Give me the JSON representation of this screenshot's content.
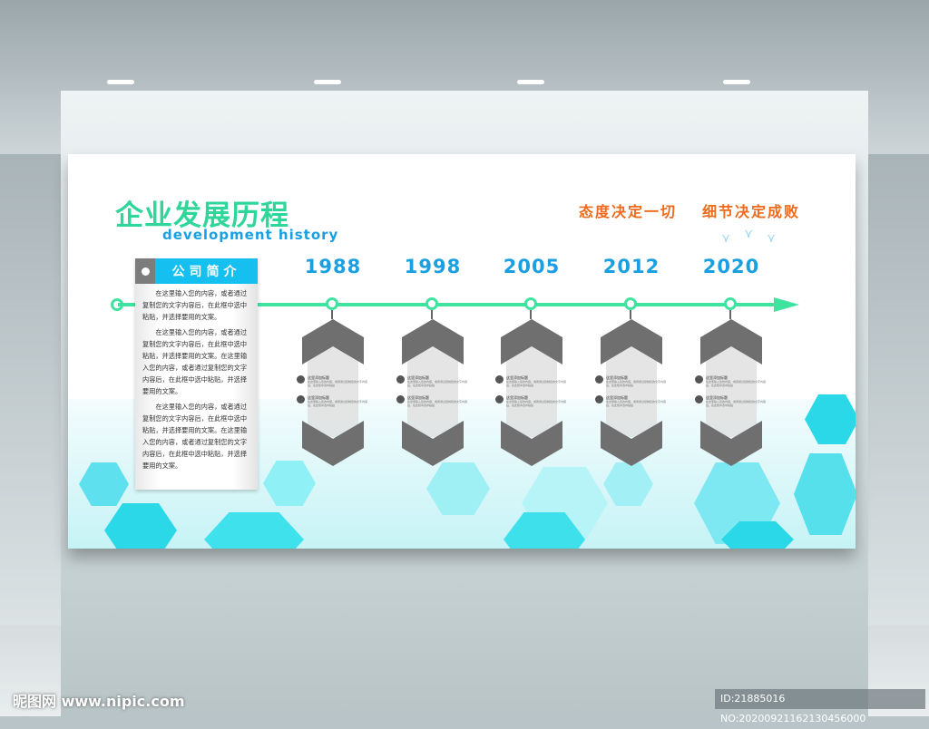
{
  "header": {
    "title": "企业发展历程",
    "subtitle": "development history"
  },
  "slogans": [
    "态度决定一切",
    "细节决定成败"
  ],
  "intro": {
    "heading": "公司简介",
    "paragraphs": [
      "在这里输入您的内容，或者通过复制您的文字内容后，在此框中选中粘贴，并选择要用的文案。",
      "在这里输入您的内容，或者通过复制您的文字内容后，在此框中选中粘贴，并选择要用的文案。在这里输入您的内容，或者通过复制您的文字内容后，在此框中选中粘贴，并选择要用的文案。",
      "在这里输入您的内容，或者通过复制您的文字内容后，在此框中选中粘贴，并选择要用的文案。在这里输入您的内容，或者通过复制您的文字内容后，在此框中选中粘贴，并选择要用的文案。"
    ]
  },
  "timeline": [
    {
      "year": "1988",
      "item_title": "这里添加标题",
      "item_text": "在这里输入您的内容，或者通过复制您的文字内容后，在此框中选中粘贴"
    },
    {
      "year": "1998",
      "item_title": "这里添加标题",
      "item_text": "在这里输入您的内容，或者通过复制您的文字内容后，在此框中选中粘贴"
    },
    {
      "year": "2005",
      "item_title": "这里添加标题",
      "item_text": "在这里输入您的内容，或者通过复制您的文字内容后，在此框中选中粘贴"
    },
    {
      "year": "2012",
      "item_title": "这里添加标题",
      "item_text": "在这里输入您的内容，或者通过复制您的文字内容后，在此框中选中粘贴"
    },
    {
      "year": "2020",
      "item_title": "这里添加标题",
      "item_text": "在这里输入您的内容，或者通过复制您的文字内容后，在此框中选中粘贴"
    }
  ],
  "watermark": "昵图网 www.nipic.com",
  "image_id": "ID:21885016 NO:20200921162130456000",
  "colors": {
    "green": "#3de39e",
    "blue": "#1aa0e0",
    "orange": "#f06a1c",
    "cyan": "#15c0f0"
  }
}
